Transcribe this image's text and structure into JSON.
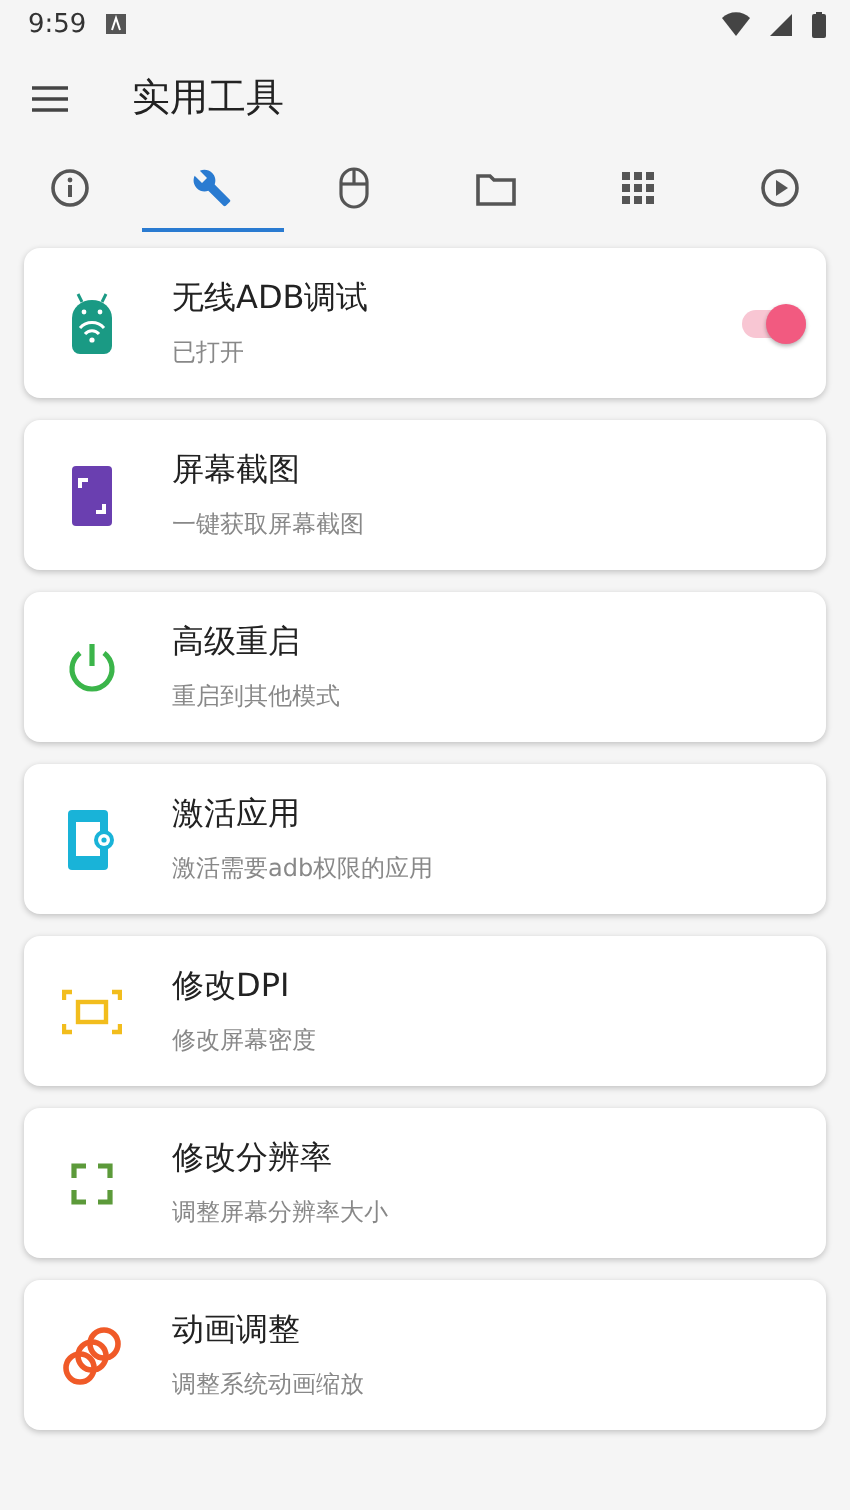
{
  "status_bar": {
    "time": "9:59"
  },
  "app_bar": {
    "title": "实用工具"
  },
  "tabs": [
    {
      "kind": "info",
      "selected": false
    },
    {
      "kind": "wrench",
      "selected": true
    },
    {
      "kind": "mouse",
      "selected": false
    },
    {
      "kind": "folder",
      "selected": false
    },
    {
      "kind": "grid",
      "selected": false
    },
    {
      "kind": "play",
      "selected": false
    }
  ],
  "tools": [
    {
      "kind": "android",
      "title": "无线ADB调试",
      "subtitle": "已打开",
      "on": true
    },
    {
      "kind": "screenshot",
      "title": "屏幕截图",
      "subtitle": "一键获取屏幕截图"
    },
    {
      "kind": "power",
      "title": "高级重启",
      "subtitle": "重启到其他模式"
    },
    {
      "kind": "appgear",
      "title": "激活应用",
      "subtitle": "激活需要adb权限的应用"
    },
    {
      "kind": "dpi",
      "title": "修改DPI",
      "subtitle": "修改屏幕密度"
    },
    {
      "kind": "resolution",
      "title": "修改分辨率",
      "subtitle": "调整屏幕分辨率大小"
    },
    {
      "kind": "rings",
      "title": "动画调整",
      "subtitle": "调整系统动画缩放"
    }
  ]
}
